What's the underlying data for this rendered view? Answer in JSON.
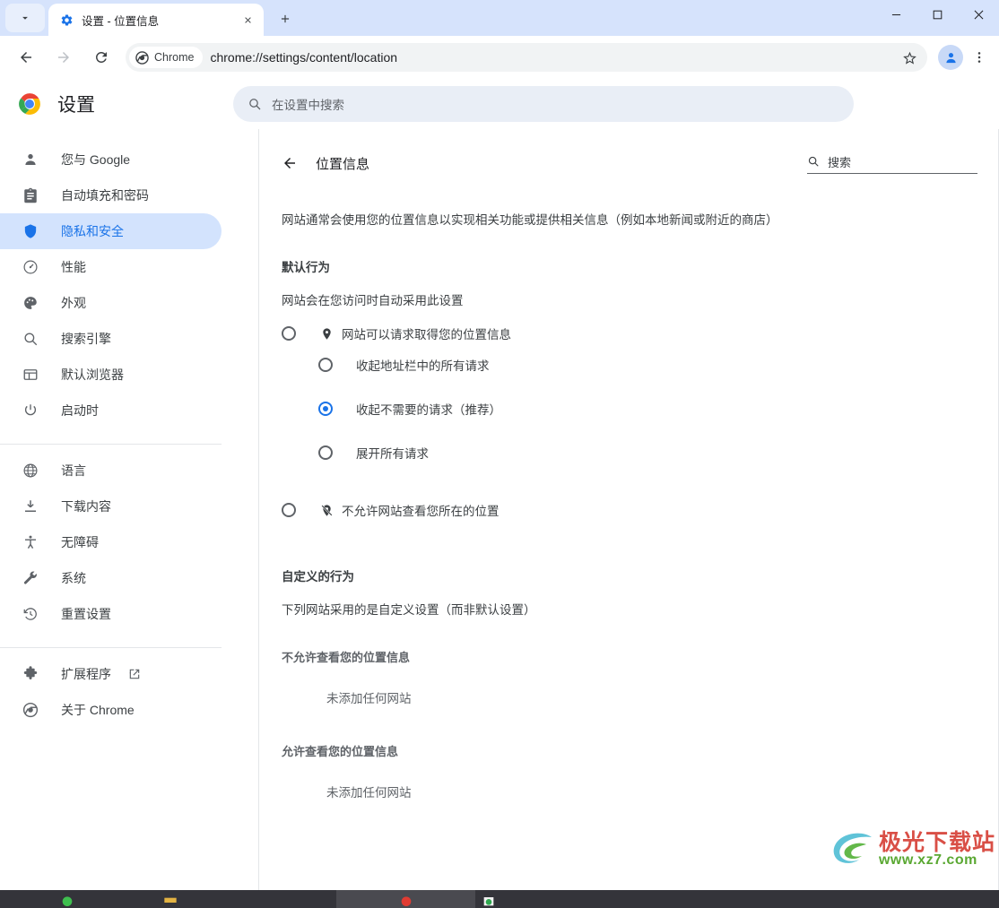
{
  "window": {
    "tab_search_icon": "chevron-down-icon",
    "tab": {
      "favicon": "settings-gear-icon",
      "title": "设置 - 位置信息",
      "close_icon": "close-icon"
    },
    "new_tab_icon": "plus-icon",
    "controls": {
      "minimize": "minimize-icon",
      "maximize": "maximize-icon",
      "close": "close-icon"
    }
  },
  "toolbar": {
    "back_icon": "arrow-back-icon",
    "forward_icon": "arrow-forward-icon",
    "reload_icon": "reload-icon",
    "chip_label": "Chrome",
    "chip_icon": "chrome-logo-icon",
    "url": "chrome://settings/content/location",
    "star_icon": "bookmark-star-icon",
    "avatar_icon": "profile-avatar-icon",
    "menu_icon": "three-dot-menu-icon"
  },
  "settings_header": {
    "logo": "chrome-logo-icon",
    "title": "设置",
    "search_icon": "search-icon",
    "search_placeholder": "在设置中搜索"
  },
  "sidebar": {
    "groups": [
      {
        "items": [
          {
            "icon": "person-icon",
            "label": "您与 Google",
            "active": false
          },
          {
            "icon": "autofill-icon",
            "label": "自动填充和密码",
            "active": false
          },
          {
            "icon": "shield-icon",
            "label": "隐私和安全",
            "active": true
          },
          {
            "icon": "performance-icon",
            "label": "性能",
            "active": false
          },
          {
            "icon": "palette-icon",
            "label": "外观",
            "active": false
          },
          {
            "icon": "search-icon",
            "label": "搜索引擎",
            "active": false
          },
          {
            "icon": "browser-icon",
            "label": "默认浏览器",
            "active": false
          },
          {
            "icon": "power-icon",
            "label": "启动时",
            "active": false
          }
        ]
      },
      {
        "items": [
          {
            "icon": "globe-icon",
            "label": "语言",
            "active": false
          },
          {
            "icon": "download-icon",
            "label": "下载内容",
            "active": false
          },
          {
            "icon": "accessibility-icon",
            "label": "无障碍",
            "active": false
          },
          {
            "icon": "wrench-icon",
            "label": "系统",
            "active": false
          },
          {
            "icon": "history-reset-icon",
            "label": "重置设置",
            "active": false
          }
        ]
      },
      {
        "items": [
          {
            "icon": "puzzle-icon",
            "label": "扩展程序",
            "active": false,
            "external": true
          },
          {
            "icon": "chrome-logo-icon",
            "label": "关于 Chrome",
            "active": false
          }
        ]
      }
    ]
  },
  "main": {
    "back_icon": "arrow-back-icon",
    "page_title": "位置信息",
    "search_icon": "search-icon",
    "search_placeholder": "搜索",
    "description": "网站通常会使用您的位置信息以实现相关功能或提供相关信息（例如本地新闻或附近的商店）",
    "default_behavior": {
      "title": "默认行为",
      "subtitle": "网站会在您访问时自动采用此设置",
      "options": [
        {
          "icon": "location-pin-icon",
          "label": "网站可以请求取得您的位置信息",
          "checked": false
        },
        {
          "icon": "location-off-icon",
          "label": "不允许网站查看您所在的位置",
          "checked": false
        }
      ],
      "sub_options": [
        {
          "label": "收起地址栏中的所有请求",
          "checked": false
        },
        {
          "label": "收起不需要的请求（推荐）",
          "checked": true
        },
        {
          "label": "展开所有请求",
          "checked": false
        }
      ]
    },
    "custom_behavior": {
      "title": "自定义的行为",
      "subtitle": "下列网站采用的是自定义设置（而非默认设置）",
      "blocked": {
        "title": "不允许查看您的位置信息",
        "empty": "未添加任何网站"
      },
      "allowed": {
        "title": "允许查看您的位置信息",
        "empty": "未添加任何网站"
      }
    }
  },
  "watermark": {
    "main": "极光下载站",
    "sub": "www.xz7.com"
  },
  "colors": {
    "accent": "#1a73e8",
    "active_pill": "#d3e3fd",
    "tabstrip": "#d6e3fc",
    "omnibox": "#f1f3f4",
    "settings_search": "#e9eef6"
  }
}
